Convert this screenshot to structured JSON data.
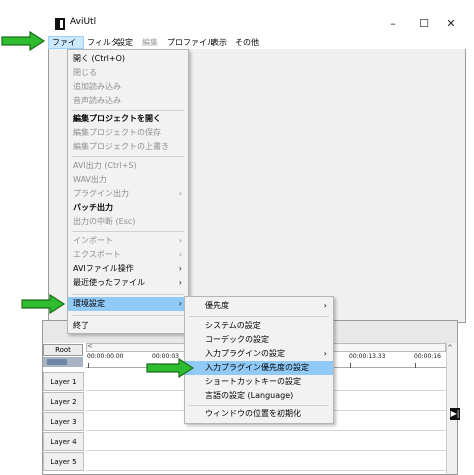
{
  "window": {
    "title": "AviUtl",
    "controls": {
      "minimize": "–",
      "maximize": "☐",
      "close": "✕"
    }
  },
  "menubar": {
    "items": [
      {
        "label": "ファイル",
        "enabled": true
      },
      {
        "label": "フィルタ",
        "enabled": true
      },
      {
        "label": "設定",
        "enabled": true
      },
      {
        "label": "編集",
        "enabled": false
      },
      {
        "label": "プロファイル",
        "enabled": true
      },
      {
        "label": "表示",
        "enabled": true
      },
      {
        "label": "その他",
        "enabled": true
      }
    ]
  },
  "file_menu": {
    "items": [
      {
        "label": "開く (Ctrl+O)",
        "enabled": true,
        "bold": false
      },
      {
        "label": "閉じる",
        "enabled": false
      },
      {
        "label": "追加読み込み",
        "enabled": false
      },
      {
        "label": "音声読み込み",
        "enabled": false
      },
      {
        "label": "編集プロジェクトを開く",
        "enabled": true,
        "bold": true
      },
      {
        "label": "編集プロジェクトの保存",
        "enabled": false
      },
      {
        "label": "編集プロジェクトの上書き",
        "enabled": false
      },
      {
        "label": "AVI出力 (Ctrl+S)",
        "enabled": false
      },
      {
        "label": "WAV出力",
        "enabled": false
      },
      {
        "label": "プラグイン出力",
        "enabled": false,
        "submenu": true
      },
      {
        "label": "バッチ出力",
        "enabled": true,
        "bold": true
      },
      {
        "label": "出力の中断 (Esc)",
        "enabled": false
      },
      {
        "label": "インポート",
        "enabled": false,
        "submenu": true
      },
      {
        "label": "エクスポート",
        "enabled": false,
        "submenu": true
      },
      {
        "label": "AVIファイル操作",
        "enabled": true,
        "submenu": true
      },
      {
        "label": "最近使ったファイル",
        "enabled": true,
        "submenu": true
      },
      {
        "label": "環境設定",
        "enabled": true,
        "submenu": true,
        "highlighted": true
      },
      {
        "label": "終了",
        "enabled": true
      }
    ],
    "submenu_arrow": "›"
  },
  "env_submenu": {
    "items": [
      {
        "label": "優先度",
        "submenu": true
      },
      {
        "label": "システムの設定"
      },
      {
        "label": "コーデックの設定"
      },
      {
        "label": "入力プラグインの設定",
        "submenu": true
      },
      {
        "label": "入力プラグイン優先度の設定",
        "highlighted": true
      },
      {
        "label": "ショートカットキーの設定"
      },
      {
        "label": "言語の設定 (Language)"
      },
      {
        "label": "ウィンドウの位置を初期化"
      }
    ]
  },
  "timeline": {
    "root_label": "Root",
    "ruler_ticks": [
      "00:00:00.00",
      "00:00:03",
      "00:00:13.33",
      "00:00:16"
    ],
    "layers": [
      "Layer 1",
      "Layer 2",
      "Layer 3",
      "Layer 4",
      "Layer 5"
    ],
    "scroll_arrow_left": "<",
    "scroll_arrow_up": "^",
    "end_button": "▶|"
  },
  "annotations": {
    "arrow_color": "#2fbd2f",
    "arrow_outline": "#1a6e1a",
    "targets": [
      "menu-file",
      "env-settings-item",
      "input-plugin-priority-item"
    ]
  }
}
